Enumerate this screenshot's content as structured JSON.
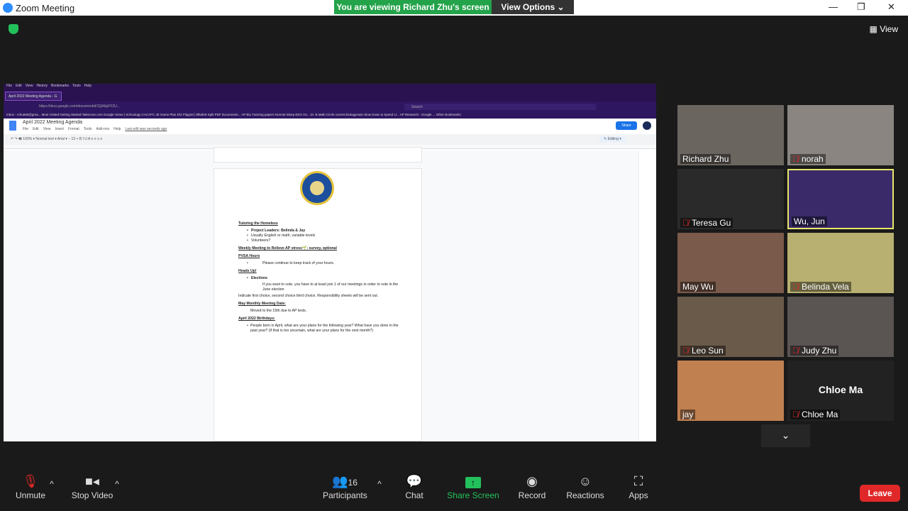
{
  "window": {
    "title": "Zoom Meeting",
    "minimize": "—",
    "maximize": "❐",
    "close": "✕"
  },
  "banner": {
    "viewing": "You are viewing Richard Zhu's screen",
    "view_options": "View Options ⌄"
  },
  "view_button": "▦ View",
  "browser": {
    "menu": [
      "File",
      "Edit",
      "View",
      "History",
      "Bookmarks",
      "Tools",
      "Help"
    ],
    "tab": "April 2022 Meeting Agenda - G",
    "url": "https://docs.google.com/document/d/1QA6pFF2U...",
    "search": "Search",
    "bookmarks": "Inbox - rchu666@gma...   Most Visited   Getting Started   Talescore.com   Google   Home | Schoology   CACAFC   JE Game Plan   D/2   Flipgrid | 8f6afe8   Split PDF Documents...   AP Bio Tutoring   papers   Normal Sleep EEG Ov...   Dr. B   Math Circle current   biologymain   Slow Down & Speed U...   AP Research - Google ...   Other Bookmarks"
  },
  "gdoc": {
    "title": "April 2022 Meeting Agenda",
    "menu": [
      "File",
      "Edit",
      "View",
      "Insert",
      "Format",
      "Tools",
      "Add-ons",
      "Help",
      "Last edit was seconds ago"
    ],
    "share": "Share",
    "toolbar": "↶ ↷ 🖶   100% ▾   Normal text ▾   Arial ▾   − 13 +   B I U A   ≡ ≡ ≡ ≡",
    "editing": "✎ Editing ▾",
    "content": {
      "h1": "Tutoring the Homeless",
      "b1": "Project Leaders: Belinda & Jay",
      "b2": "Usually English or math, variable levels",
      "b3": "Volunteers?",
      "h2": "Weekly Meeting to Relieve AP stress🌱: survey, optional",
      "h3": "PVSA Hours",
      "b4": "Please continue to keep track of your hours.",
      "h4": "Heads Up!",
      "b5": "Elections",
      "b6": "If you want to vote, you have to at least join 1 of our meetings in order to vote in the June election",
      "p1": "Indicate first choice, second choice third choice. Responsibility sheets will be sent out.",
      "h5": "May Monthly Meeting Date:",
      "p2": "Moved to the 15th due to AP tests.",
      "h6": "April 2022 Birthdays:",
      "b7": "People born in April, what are your plans for the following year? What have you done in the past year? (If that is too uncertain, what are your plans for the next month?)"
    }
  },
  "participants": [
    {
      "name": "Richard Zhu",
      "muted": false,
      "bg": "#6b6560"
    },
    {
      "name": "norah",
      "muted": true,
      "bg": "#8a8580"
    },
    {
      "name": "Teresa Gu",
      "muted": true,
      "bg": "#2a2a2a"
    },
    {
      "name": "Wu, Jun",
      "muted": false,
      "bg": "#3a2a6a"
    },
    {
      "name": "May Wu",
      "muted": false,
      "bg": "#7a5a4a"
    },
    {
      "name": "Belinda Vela",
      "muted": true,
      "bg": "#b8b070"
    },
    {
      "name": "Leo Sun",
      "muted": true,
      "bg": "#6a5a4a"
    },
    {
      "name": "Judy Zhu",
      "muted": true,
      "bg": "#5a5452"
    },
    {
      "name": "jay",
      "muted": false,
      "bg": "#c08050"
    },
    {
      "name": "Chloe Ma",
      "muted": true,
      "bg": "#222",
      "big": "Chloe Ma"
    }
  ],
  "toolbar": {
    "unmute": "Unmute",
    "stop_video": "Stop Video",
    "participants": "Participants",
    "count": "16",
    "chat": "Chat",
    "share": "Share Screen",
    "record": "Record",
    "reactions": "Reactions",
    "apps": "Apps",
    "leave": "Leave"
  },
  "colors": {
    "share_green": "#23c15b",
    "leave_red": "#e02828",
    "active_border": "#e8e86a"
  }
}
